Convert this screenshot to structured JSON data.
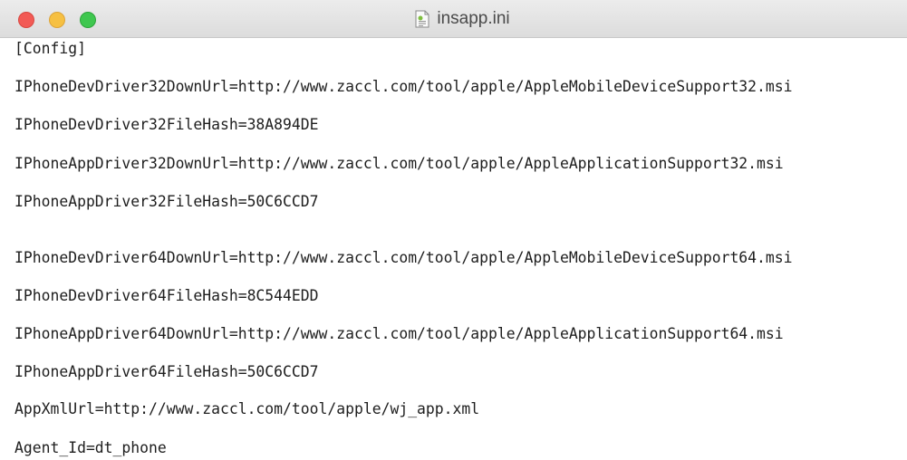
{
  "window": {
    "title": "insapp.ini",
    "title_icon": "text-document-icon",
    "buttons": [
      "close",
      "minimize",
      "zoom"
    ]
  },
  "lines": [
    "[Config]",
    "IPhoneDevDriver32DownUrl=http://www.zaccl.com/tool/apple/AppleMobileDeviceSupport32.msi",
    "IPhoneDevDriver32FileHash=38A894DE",
    "IPhoneAppDriver32DownUrl=http://www.zaccl.com/tool/apple/AppleApplicationSupport32.msi",
    "IPhoneAppDriver32FileHash=50C6CCD7",
    "IPhoneDevDriver64DownUrl=http://www.zaccl.com/tool/apple/AppleMobileDeviceSupport64.msi",
    "IPhoneDevDriver64FileHash=8C544EDD",
    "IPhoneAppDriver64DownUrl=http://www.zaccl.com/tool/apple/AppleApplicationSupport64.msi",
    "IPhoneAppDriver64FileHash=50C6CCD7",
    "AppXmlUrl=http://www.zaccl.com/tool/apple/wj_app.xml",
    "Agent_Id=dt_phone"
  ],
  "colors": {
    "close": "#f25a55",
    "minimize": "#f6c042",
    "zoom": "#3fc74f",
    "text": "#1e1e1e"
  }
}
